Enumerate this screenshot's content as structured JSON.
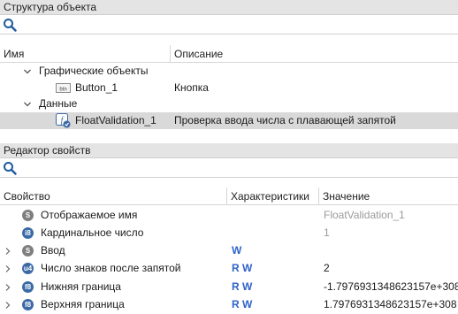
{
  "structure": {
    "title": "Структура объекта",
    "search_placeholder": "",
    "columns": {
      "name": "Имя",
      "description": "Описание"
    },
    "tree": {
      "graphics_group": "Графические объекты",
      "button_name": "Button_1",
      "button_desc": "Кнопка",
      "data_group": "Данные",
      "floatval_name": "FloatValidation_1",
      "floatval_desc": "Проверка ввода числа с плавающей запятой"
    }
  },
  "props": {
    "title": "Редактор свойств",
    "search_placeholder": "",
    "columns": {
      "property": "Свойство",
      "characteristics": "Характеристики",
      "value": "Значение"
    },
    "rows": [
      {
        "badge": "S",
        "name": "Отображаемое имя",
        "flags": "",
        "value": "FloatValidation_1",
        "muted": true,
        "expandable": false
      },
      {
        "badge": "i8",
        "name": "Кардинальное число",
        "flags": "",
        "value": "1",
        "muted": true,
        "expandable": false
      },
      {
        "badge": "S",
        "name": "Ввод",
        "flags": "W",
        "value": "",
        "muted": false,
        "expandable": true
      },
      {
        "badge": "u4",
        "name": "Число знаков после запятой",
        "flags": "R W",
        "value": "2",
        "muted": false,
        "expandable": true
      },
      {
        "badge": "f8",
        "name": "Нижняя граница",
        "flags": "R W",
        "value": "-1.7976931348623157e+308",
        "muted": false,
        "expandable": true
      },
      {
        "badge": "f8",
        "name": "Верхняя граница",
        "flags": "R W",
        "value": "1.7976931348623157e+308",
        "muted": false,
        "expandable": true
      }
    ]
  },
  "icons": {
    "search": "search-icon",
    "expand_open": "chevron-down-icon",
    "expand_closed": "chevron-right-icon",
    "button_obj": "button-object-icon",
    "float_obj": "float-validation-icon"
  },
  "colors": {
    "selected_row": "#d9d9d9",
    "header_bg": "#e4e4e4",
    "flag_blue": "#2f63c9",
    "badge_gray": "#7f7f7f",
    "badge_blue": "#3c6aa6"
  }
}
